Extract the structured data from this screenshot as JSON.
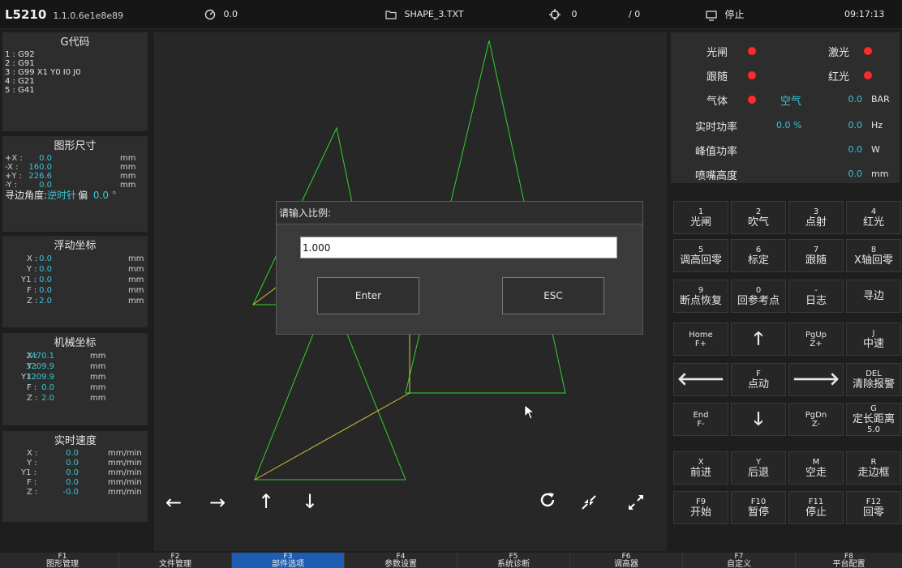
{
  "topbar": {
    "model": "L5210",
    "version": "1.1.0.6e1e8e89",
    "speed": "0.0",
    "file": "SHAPE_3.TXT",
    "count_a": "0",
    "count_b": "/ 0",
    "state": "停止",
    "time": "09:17:13"
  },
  "gcode": {
    "title": "G代码",
    "lines": [
      "1 : G92",
      "2 : G91",
      "3 : G99 X1 Y0 I0 J0",
      "4 : G21",
      "5 : G41"
    ]
  },
  "shape_size": {
    "title": "图形尺寸",
    "rows": [
      {
        "k": "+X :",
        "v": "0.0",
        "u": "mm"
      },
      {
        "k": "-X :",
        "v": "160.0",
        "u": "mm"
      },
      {
        "k": "+Y :",
        "v": "226.6",
        "u": "mm"
      },
      {
        "k": "-Y :",
        "v": "0.0",
        "u": "mm"
      }
    ],
    "edge_label": "寻边角度:",
    "edge_dir": "逆时针",
    "edge_bias": "偏",
    "edge_value": "0.0 °"
  },
  "float_coord": {
    "title": "浮动坐标",
    "rows": [
      {
        "k": "X :",
        "v": "0.0",
        "u": "mm"
      },
      {
        "k": "Y :",
        "v": "0.0",
        "u": "mm"
      },
      {
        "k": "Y1 :",
        "v": "0.0",
        "u": "mm"
      },
      {
        "k": "F :",
        "v": "0.0",
        "u": "mm"
      },
      {
        "k": "Z :",
        "v": "2.0",
        "u": "mm"
      }
    ]
  },
  "mach_coord": {
    "title": "机械坐标",
    "rows": [
      {
        "k": "X :",
        "v": "2470.1",
        "u": "mm"
      },
      {
        "k": "Y :",
        "v": "3209.9",
        "u": "mm"
      },
      {
        "k": "Y1 :",
        "v": "3209.9",
        "u": "mm"
      },
      {
        "k": "F :",
        "v": "0.0",
        "u": "mm"
      },
      {
        "k": "Z :",
        "v": "2.0",
        "u": "mm"
      }
    ]
  },
  "real_speed": {
    "title": "实时速度",
    "rows": [
      {
        "k": "X :",
        "v": "0.0",
        "u": "mm/min"
      },
      {
        "k": "Y :",
        "v": "0.0",
        "u": "mm/min"
      },
      {
        "k": "Y1 :",
        "v": "0.0",
        "u": "mm/min"
      },
      {
        "k": "F :",
        "v": "0.0",
        "u": "mm/min"
      },
      {
        "k": "Z :",
        "v": "-0.0",
        "u": "mm/min"
      }
    ]
  },
  "status": {
    "shutter": "光闸",
    "laser": "激光",
    "follow": "跟随",
    "redlight": "红光",
    "gas": "气体",
    "gas_type": "空气",
    "gas_value": "0.0",
    "gas_unit": "BAR",
    "real_power": "实时功率",
    "real_power_pct": "0.0 %",
    "real_power_hz": "0.0",
    "hz_unit": "Hz",
    "peak_power": "峰值功率",
    "peak_value": "0.0",
    "w_unit": "W",
    "nozzle_height": "喷嘴高度",
    "nozzle_value": "0.0",
    "mm_unit": "mm"
  },
  "keypad": [
    [
      {
        "s": "1",
        "m": "光闸"
      },
      {
        "s": "2",
        "m": "吹气"
      },
      {
        "s": "3",
        "m": "点射"
      },
      {
        "s": "4",
        "m": "红光"
      }
    ],
    [
      {
        "s": "5",
        "m": "调高回零"
      },
      {
        "s": "6",
        "m": "标定"
      },
      {
        "s": "7",
        "m": "跟随"
      },
      {
        "s": "8",
        "m": "X轴回零"
      }
    ],
    [
      {
        "s": "9",
        "m": "断点恢复"
      },
      {
        "s": "0",
        "m": "回参考点"
      },
      {
        "s": "-",
        "m": "日志"
      },
      {
        "s": "",
        "m": "寻边"
      }
    ],
    [
      {
        "s": "Home",
        "m": "F+"
      },
      {
        "s": "",
        "m": ""
      },
      {
        "s": "PgUp",
        "m": "Z+"
      },
      {
        "s": "J",
        "m": "中速"
      }
    ],
    [
      {
        "s": "",
        "m": ""
      },
      {
        "s": "F",
        "m": "点动"
      },
      {
        "s": "",
        "m": ""
      },
      {
        "s": "DEL",
        "m": "清除报警"
      }
    ],
    [
      {
        "s": "End",
        "m": "F-"
      },
      {
        "s": "",
        "m": ""
      },
      {
        "s": "PgDn",
        "m": "Z-"
      },
      {
        "s": "G",
        "m": "定长距离",
        "x": "5.0"
      }
    ],
    [
      {
        "s": "X",
        "m": "前进"
      },
      {
        "s": "Y",
        "m": "后退"
      },
      {
        "s": "M",
        "m": "空走"
      },
      {
        "s": "R",
        "m": "走边框"
      }
    ],
    [
      {
        "s": "F9",
        "m": "开始"
      },
      {
        "s": "F10",
        "m": "暂停"
      },
      {
        "s": "F11",
        "m": "停止"
      },
      {
        "s": "F12",
        "m": "回零"
      }
    ]
  ],
  "fkeys": [
    {
      "a": "F1",
      "b": "图形管理"
    },
    {
      "a": "F2",
      "b": "文件管理"
    },
    {
      "a": "F3",
      "b": "部件选项"
    },
    {
      "a": "F4",
      "b": "参数设置"
    },
    {
      "a": "F5",
      "b": "系统诊断"
    },
    {
      "a": "F6",
      "b": "调高器"
    },
    {
      "a": "F7",
      "b": "自定义"
    },
    {
      "a": "F8",
      "b": "平台配置"
    }
  ],
  "dialog": {
    "title": "请输入比例:",
    "value": "1.000",
    "enter": "Enter",
    "esc": "ESC"
  },
  "colors": {
    "accent": "#1f5db1",
    "value_cyan": "#39c4d8",
    "indicator_red": "#ff2a2a",
    "shape_green": "#2fd32f",
    "path_yellow": "#d7c632"
  }
}
